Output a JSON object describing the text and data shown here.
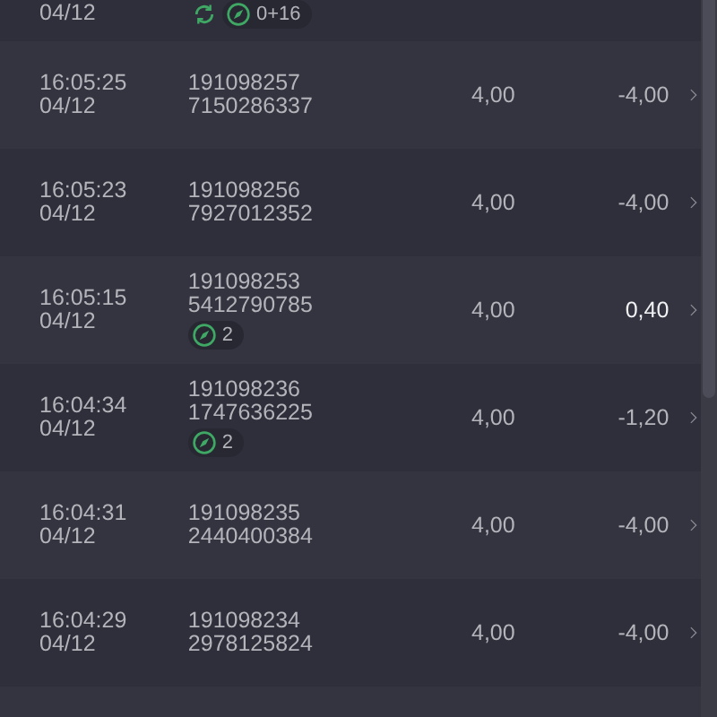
{
  "bets": [
    {
      "date": "04/12",
      "sync": true,
      "badge": "0+16"
    },
    {
      "time": "16:05:25",
      "date": "04/12",
      "ids": [
        "191098257",
        "7150286337"
      ],
      "stake": "4,00",
      "profit": "-4,00",
      "won": false,
      "sync": false
    },
    {
      "time": "16:05:23",
      "date": "04/12",
      "ids": [
        "191098256",
        "7927012352"
      ],
      "stake": "4,00",
      "profit": "-4,00",
      "won": false,
      "sync": false
    },
    {
      "time": "16:05:15",
      "date": "04/12",
      "ids": [
        "191098253",
        "5412790785"
      ],
      "stake": "4,00",
      "profit": "0,40",
      "won": true,
      "sync": false,
      "badge": "2"
    },
    {
      "time": "16:04:34",
      "date": "04/12",
      "ids": [
        "191098236",
        "1747636225"
      ],
      "stake": "4,00",
      "profit": "-1,20",
      "won": false,
      "sync": false,
      "badge": "2"
    },
    {
      "time": "16:04:31",
      "date": "04/12",
      "ids": [
        "191098235",
        "2440400384"
      ],
      "stake": "4,00",
      "profit": "-4,00",
      "won": false,
      "sync": false
    },
    {
      "time": "16:04:29",
      "date": "04/12",
      "ids": [
        "191098234",
        "2978125824"
      ],
      "stake": "4,00",
      "profit": "-4,00",
      "won": false,
      "sync": false
    }
  ]
}
